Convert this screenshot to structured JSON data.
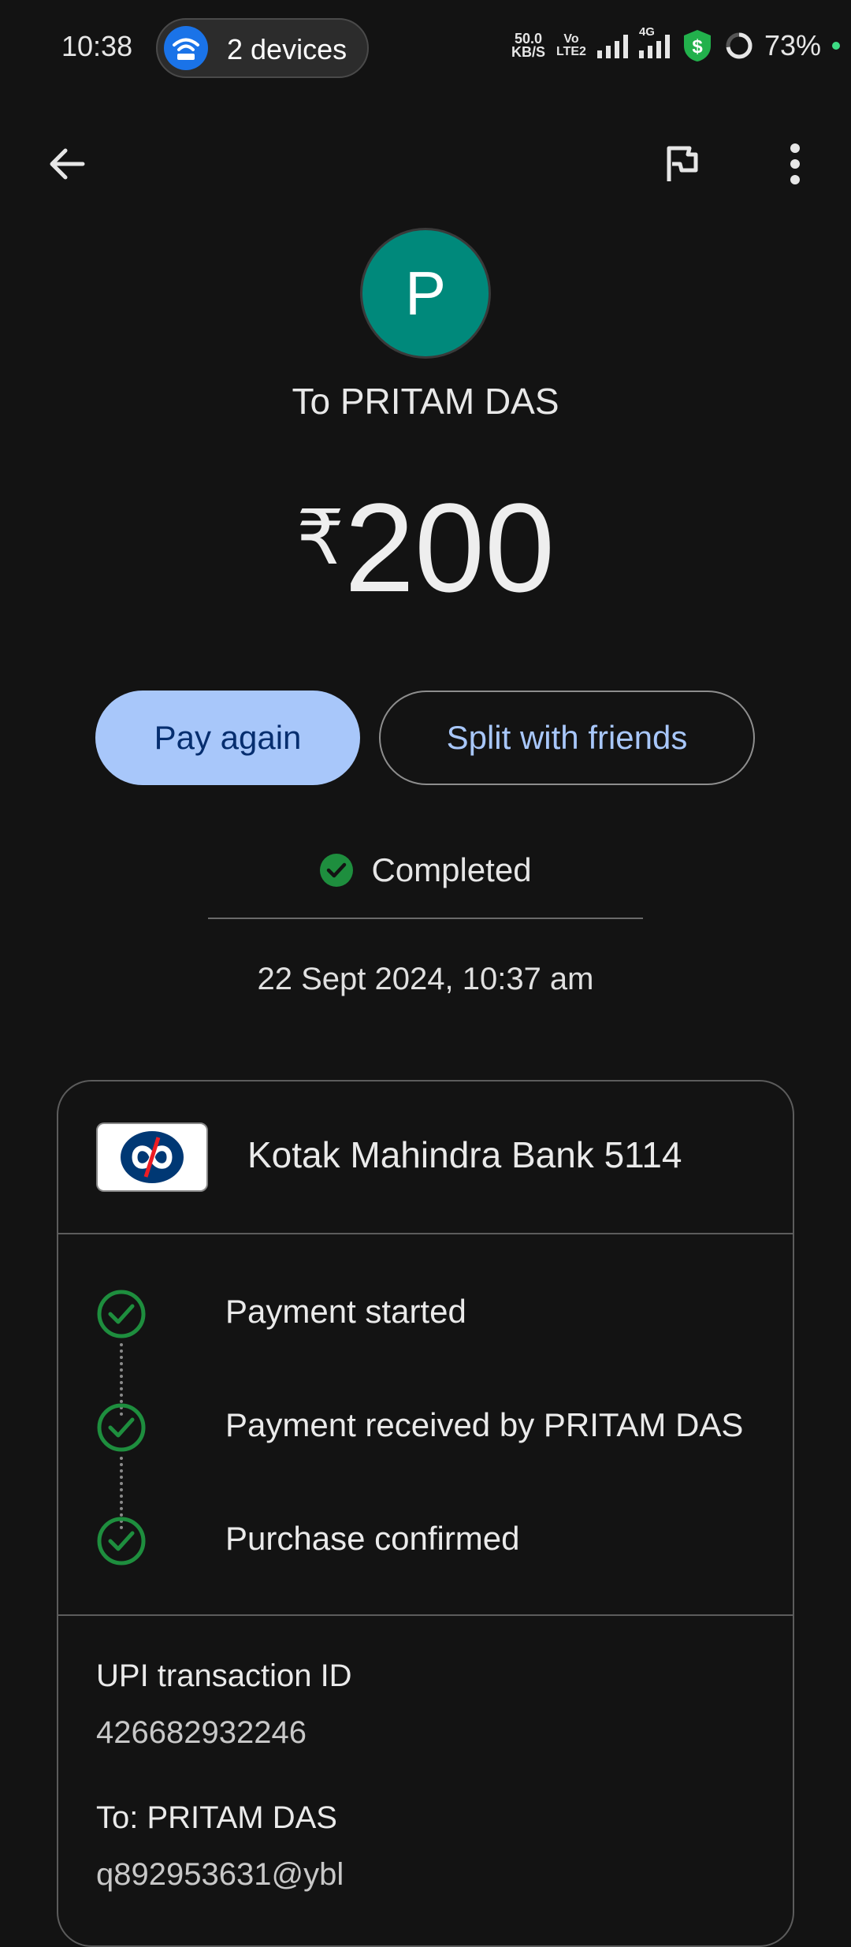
{
  "status_bar": {
    "time": "10:38",
    "hotspot_label": "2 devices",
    "net_speed_value": "50.0",
    "net_speed_unit": "KB/S",
    "volte_top": "Vo",
    "volte_bottom": "LTE2",
    "network_type": "4G",
    "battery": "73%"
  },
  "payee": {
    "initial": "P",
    "title": "To PRITAM DAS",
    "avatar_color": "#00897b"
  },
  "amount": {
    "currency": "₹",
    "value": "200"
  },
  "actions": {
    "pay_again": "Pay again",
    "split": "Split with friends"
  },
  "status": {
    "label": "Completed",
    "datetime": "22 Sept 2024, 10:37 am"
  },
  "bank": {
    "name": "Kotak Mahindra Bank 5114"
  },
  "steps": [
    {
      "label": "Payment started"
    },
    {
      "label": "Payment received by PRITAM DAS"
    },
    {
      "label": "Purchase confirmed"
    }
  ],
  "details": {
    "upi_label": "UPI transaction ID",
    "upi_value": "426682932246",
    "to_label": "To: PRITAM DAS",
    "to_value": "q892953631@ybl"
  },
  "colors": {
    "background": "#131313",
    "accent": "#a8c7fa",
    "success": "#1e8e3e"
  }
}
